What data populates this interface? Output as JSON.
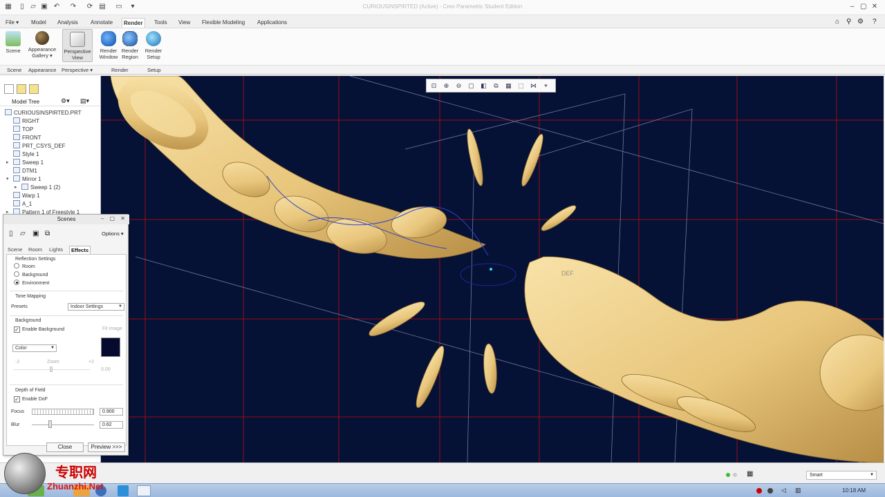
{
  "app": {
    "title": "CURIOUSINSPIRTED (Active) - Creo Parametric Student Edition"
  },
  "ribbon": {
    "file_tab": "File ▾",
    "tabs": [
      "Model",
      "Analysis",
      "Annotate",
      "Render",
      "Tools",
      "View",
      "Flexible Modeling",
      "Applications"
    ],
    "active_tab": "Render",
    "buttons": [
      {
        "label1": "Scene",
        "label2": "",
        "icon": "scene-icon"
      },
      {
        "label1": "Appearance",
        "label2": "Gallery ▾",
        "icon": "sphere-icon"
      },
      {
        "label1": "Perspective",
        "label2": "View",
        "icon": "perspective-cube-icon"
      },
      {
        "label1": "Render",
        "label2": "Window",
        "icon": "teapot-icon"
      },
      {
        "label1": "Render",
        "label2": "Region",
        "icon": "teapot-region-icon"
      },
      {
        "label1": "Render",
        "label2": "Setup",
        "icon": "globe-icon"
      }
    ],
    "groups": [
      "Scene",
      "Appearance",
      "Perspective ▾",
      "Render",
      "Setup"
    ]
  },
  "model_tree": {
    "title": "Model Tree",
    "items": [
      {
        "label": "CURIOUSINSPIRTED.PRT",
        "indent": 0,
        "expander": ""
      },
      {
        "label": "RIGHT",
        "indent": 1,
        "expander": ""
      },
      {
        "label": "TOP",
        "indent": 1,
        "expander": ""
      },
      {
        "label": "FRONT",
        "indent": 1,
        "expander": ""
      },
      {
        "label": "PRT_CSYS_DEF",
        "indent": 1,
        "expander": ""
      },
      {
        "label": "Style 1",
        "indent": 1,
        "expander": ""
      },
      {
        "label": "Sweep 1",
        "indent": 1,
        "expander": "▸"
      },
      {
        "label": "DTM1",
        "indent": 1,
        "expander": ""
      },
      {
        "label": "Mirror 1",
        "indent": 1,
        "expander": "▾"
      },
      {
        "label": "Sweep 1 (2)",
        "indent": 2,
        "expander": "▸"
      },
      {
        "label": "Warp 1",
        "indent": 1,
        "expander": ""
      },
      {
        "label": "A_1",
        "indent": 1,
        "expander": ""
      },
      {
        "label": "Pattern 1 of Freestyle 1",
        "indent": 1,
        "expander": "▸"
      }
    ]
  },
  "scenes_dialog": {
    "title": "Scenes",
    "options_label": "Options ▾",
    "tabs": [
      "Scene",
      "Room",
      "Lights",
      "Effects"
    ],
    "active_tab": "Effects",
    "reflection": {
      "heading": "Reflection Settings",
      "options": [
        "Room",
        "Background",
        "Environment"
      ],
      "selected": "Environment"
    },
    "tone_mapping": {
      "heading": "Tone Mapping",
      "presets_label": "Presets",
      "presets_value": "Indoor Settings"
    },
    "background": {
      "heading": "Background",
      "enable_label": "Enable Background",
      "enabled": true,
      "fit_image_label": "Fit image",
      "type_value": "Color",
      "swatch_color": "#050a2e",
      "zoom_min": "-2",
      "zoom_label": "Zoom",
      "zoom_max": "+2",
      "zoom_value": "0.00"
    },
    "depth_of_field": {
      "heading": "Depth of Field",
      "enable_label": "Enable DoF",
      "enabled": true,
      "focus_label": "Focus",
      "focus_value": "0.900",
      "blur_label": "Blur",
      "blur_value": "0.62"
    },
    "close_label": "Close",
    "preview_label": "Preview >>>"
  },
  "viewport": {
    "background_color": "#061136",
    "model_color": "#f0d38c",
    "datum_label": "DEF"
  },
  "status": {
    "filter_value": "Smart"
  },
  "taskbar": {
    "clock": "10:18 AM"
  },
  "watermark": {
    "cn": "专职网",
    "en": "Zhuanzhi.Net"
  }
}
